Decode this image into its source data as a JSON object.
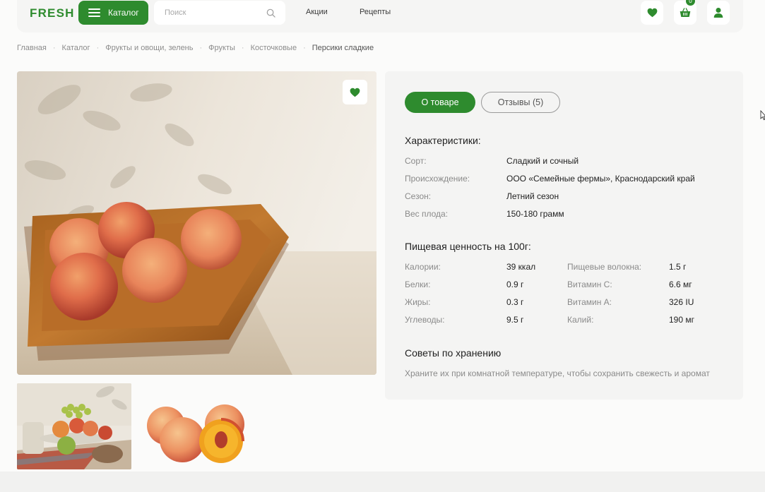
{
  "header": {
    "logo": "FRESH",
    "catalog_label": "Каталог",
    "search_placeholder": "Поиск",
    "nav": [
      "Акции",
      "Рецепты"
    ],
    "cart_count": "0",
    "accent_color": "#2e8b2e"
  },
  "breadcrumb": [
    "Главная",
    "Каталог",
    "Фрукты и овощи, зелень",
    "Фрукты",
    "Косточковые",
    "Персики сладкие"
  ],
  "tabs": {
    "about": "О товаре",
    "reviews": "Отзывы (5)"
  },
  "characteristics": {
    "title": "Характеристики:",
    "rows": [
      {
        "label": "Сорт:",
        "value": "Сладкий и сочный"
      },
      {
        "label": "Происхождение:",
        "value": "ООО «Семейные фермы», Краснодарский край"
      },
      {
        "label": "Сезон:",
        "value": "Летний сезон"
      },
      {
        "label": "Вес плода:",
        "value": "150-180 грамм"
      }
    ]
  },
  "nutrition": {
    "title": "Пищевая ценность на 100г:",
    "left": [
      {
        "label": "Калории:",
        "value": "39 ккал"
      },
      {
        "label": "Белки:",
        "value": "0.9 г"
      },
      {
        "label": "Жиры:",
        "value": "0.3 г"
      },
      {
        "label": "Углеводы:",
        "value": "9.5 г"
      }
    ],
    "right": [
      {
        "label": "Пищевые волокна:",
        "value": "1.5 г"
      },
      {
        "label": "Витамин С:",
        "value": "6.6 мг"
      },
      {
        "label": "Витамин А:",
        "value": "326 IU"
      },
      {
        "label": "Калий:",
        "value": "190 мг"
      }
    ]
  },
  "storage": {
    "title": "Советы по хранению",
    "text": "Храните их при комнатной температуре, чтобы сохранить свежесть и аромат"
  }
}
